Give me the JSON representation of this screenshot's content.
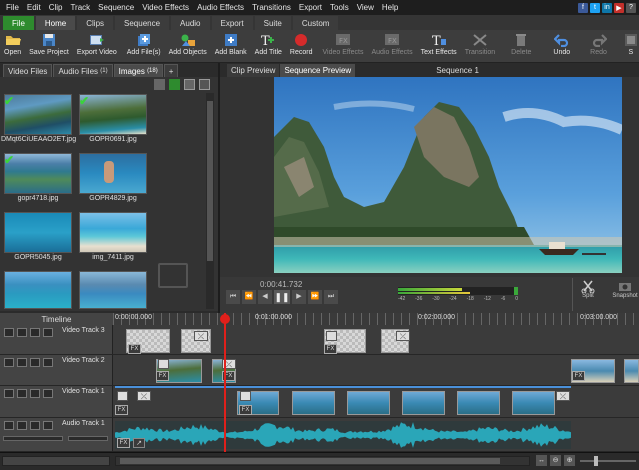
{
  "menu": [
    "File",
    "Edit",
    "Clip",
    "Track",
    "Sequence",
    "Video Effects",
    "Audio Effects",
    "Transitions",
    "Export",
    "Tools",
    "View",
    "Help"
  ],
  "ribbon_tabs": [
    "File",
    "Home",
    "Clips",
    "Sequence",
    "Audio",
    "Export",
    "Suite",
    "Custom"
  ],
  "toolbar": {
    "open": "Open",
    "save_project": "Save Project",
    "export_video": "Export Video",
    "add_files": "Add File(s)",
    "add_objects": "Add Objects",
    "add_blank": "Add Blank",
    "add_title": "Add Title",
    "record": "Record",
    "video_effects": "Video Effects",
    "audio_effects": "Audio Effects",
    "text_effects": "Text Effects",
    "transition": "Transition",
    "delete": "Delete",
    "undo": "Undo",
    "redo": "Redo",
    "s": "S"
  },
  "media_tabs": {
    "video_files": "Video Files",
    "audio_files": "Audio Files",
    "audio_count": "(1)",
    "images": "Images",
    "images_count": "(18)",
    "add": "+"
  },
  "media_items": [
    {
      "name": "DMqt6CiUEAAO2ET.jpg",
      "checked": true
    },
    {
      "name": "GOPR0691.jpg",
      "checked": true
    },
    {
      "name": "gopr4718.jpg",
      "checked": true
    },
    {
      "name": "GOPR4829.jpg",
      "checked": false
    },
    {
      "name": "GOPR5045.jpg",
      "checked": false
    },
    {
      "name": "img_7411.jpg",
      "checked": false
    },
    {
      "name": "",
      "checked": false
    },
    {
      "name": "",
      "checked": false
    }
  ],
  "preview": {
    "tab_clip": "Clip Preview",
    "tab_sequence": "Sequence Preview",
    "title": "Sequence 1",
    "timecode": "0:00:41.732",
    "meter_labels": [
      "-42",
      "-36",
      "-30",
      "-24",
      "-18",
      "-12",
      "-6",
      "0"
    ],
    "split": "Split",
    "snapshot": "Snapshot"
  },
  "timeline": {
    "label": "Timeline",
    "ticks": [
      "0:00:00.000",
      "0:01:00.000",
      "0:02:00.000",
      "0:03:00.000"
    ],
    "tracks": [
      "Video Track 3",
      "Video Track 2",
      "Video Track 1",
      "Audio Track 1"
    ]
  },
  "fx": "FX",
  "colors": {
    "accent_green": "#2e8b2e",
    "playhead": "#e0201b",
    "waveform": "#2aa6b8",
    "selection": "#4a90d9"
  }
}
